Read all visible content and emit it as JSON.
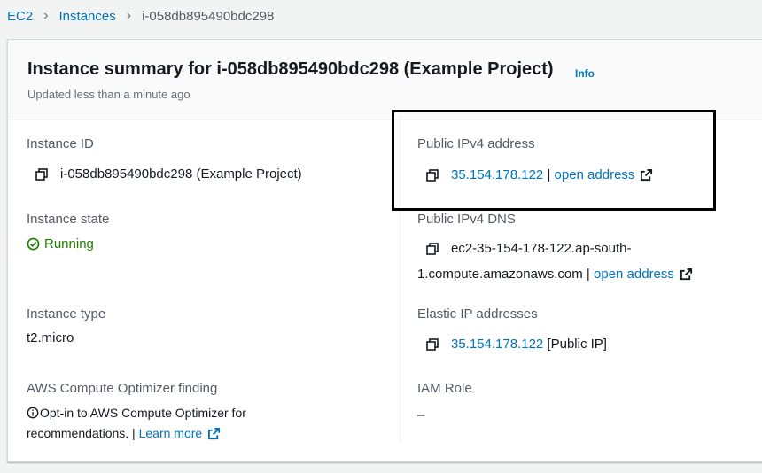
{
  "breadcrumb": {
    "items": [
      "EC2",
      "Instances"
    ],
    "current": "i-058db895490bdc298"
  },
  "header": {
    "title": "Instance summary for i-058db895490bdc298 (Example Project)",
    "info": "Info",
    "subtitle": "Updated less than a minute ago"
  },
  "fields": {
    "instance_id": {
      "label": "Instance ID",
      "value": "i-058db895490bdc298 (Example Project)"
    },
    "public_ipv4": {
      "label": "Public IPv4 address",
      "value": "35.154.178.122",
      "sep": " | ",
      "link": "open address"
    },
    "instance_state": {
      "label": "Instance state",
      "value": "Running"
    },
    "public_dns": {
      "label": "Public IPv4 DNS",
      "line1": "ec2-35-154-178-122.ap-south-",
      "line2": "1.compute.amazonaws.com",
      "sep": " | ",
      "link": "open address"
    },
    "instance_type": {
      "label": "Instance type",
      "value": "t2.micro"
    },
    "elastic_ip": {
      "label": "Elastic IP addresses",
      "value": "35.154.178.122",
      "suffix": " [Public IP]"
    },
    "optimizer": {
      "label": "AWS Compute Optimizer finding",
      "line1": "Opt-in to AWS Compute Optimizer for",
      "line2": "recommendations.",
      "sep": " | ",
      "link": "Learn more"
    },
    "iam_role": {
      "label": "IAM Role",
      "value": "–"
    }
  },
  "colors": {
    "link": "#0073bb",
    "running": "#1d8102",
    "label": "#545b64"
  }
}
